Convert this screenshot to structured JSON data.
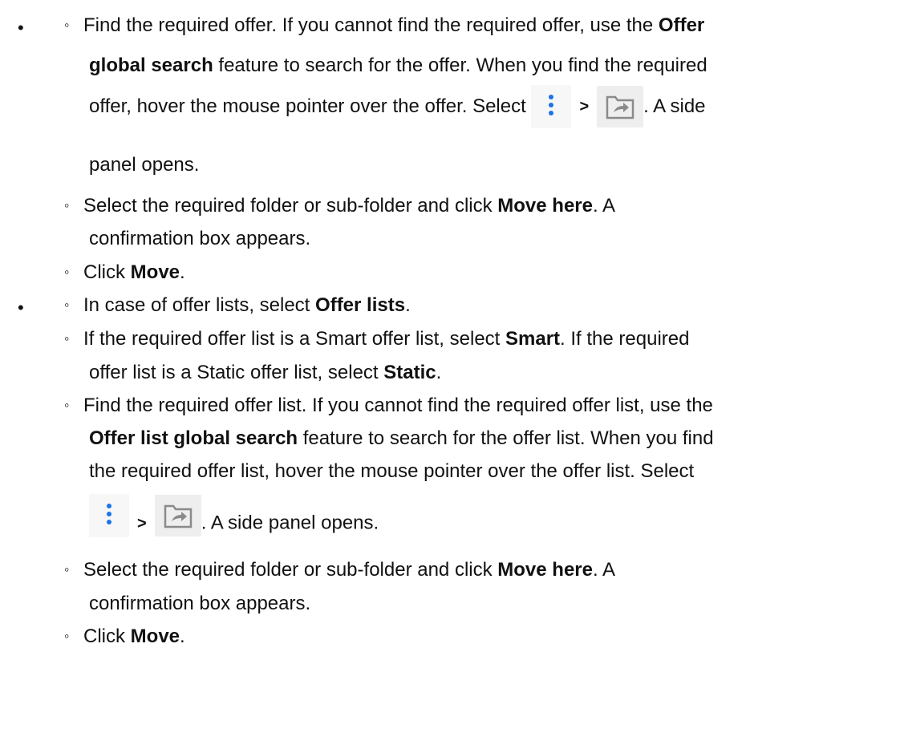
{
  "bullet_char": "•",
  "sub_bullet_char": "◦",
  "icons": {
    "kebab": "vertical-dots-icon",
    "move": "move-to-folder-icon",
    "kebab_color": "#1a73e8"
  },
  "section1": {
    "step1": {
      "t1": "Find the required offer. If you cannot find the required offer, use the ",
      "b1": "Offer",
      "b2": "global search",
      "t2": " feature to search for the offer. When you find the required",
      "t3": "offer, hover the mouse pointer over the offer. Select",
      "sep": ">",
      "t4": ". A side",
      "t5": "panel opens."
    },
    "step2": {
      "t1": "Select the required folder or sub-folder and click ",
      "b1": "Move here",
      "t2": ". A",
      "t3": "confirmation box appears."
    },
    "step3": {
      "t1": "Click ",
      "b1": "Move",
      "t2": "."
    }
  },
  "section2": {
    "step1": {
      "t1": "In case of offer lists, select ",
      "b1": "Offer lists",
      "t2": "."
    },
    "step2": {
      "t1": "If the required offer list is a Smart offer list, select ",
      "b1": "Smart",
      "t2": ". If the required",
      "t3": "offer list is a Static offer list, select ",
      "b2": "Static",
      "t4": "."
    },
    "step3": {
      "t1": "Find the required offer list. If you cannot find the required offer list, use the",
      "b1": "Offer list global search",
      "t2": " feature to search for the offer list. When you find",
      "t3": "the required offer list, hover the mouse pointer over the offer list. Select",
      "sep": ">",
      "t4": ". A side panel opens."
    },
    "step4": {
      "t1": "Select the required folder or sub-folder and click ",
      "b1": "Move here",
      "t2": ". A",
      "t3": "confirmation box appears."
    },
    "step5": {
      "t1": "Click ",
      "b1": "Move",
      "t2": "."
    }
  }
}
